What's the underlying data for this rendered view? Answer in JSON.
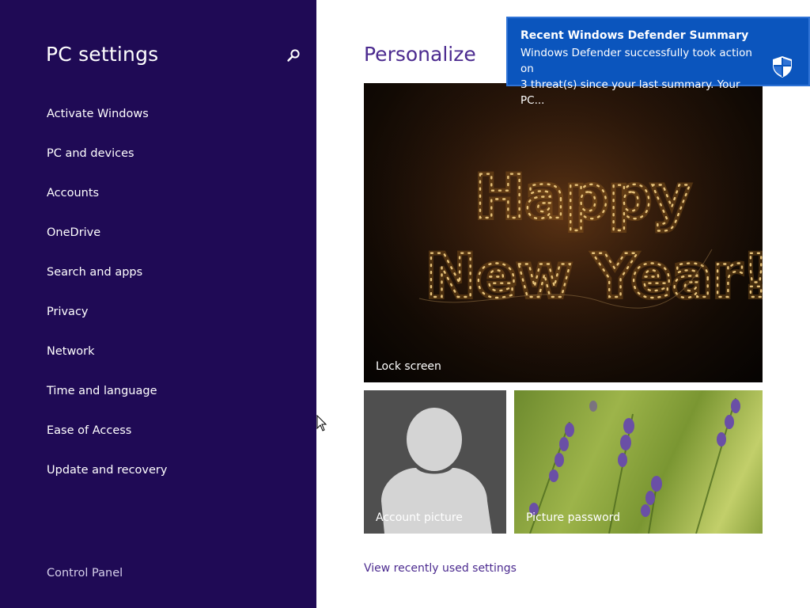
{
  "sidebar": {
    "title": "PC settings",
    "search_icon": "search-icon",
    "items": [
      {
        "label": "Activate Windows"
      },
      {
        "label": "PC and devices"
      },
      {
        "label": "Accounts"
      },
      {
        "label": "OneDrive"
      },
      {
        "label": "Search and apps"
      },
      {
        "label": "Privacy"
      },
      {
        "label": "Network"
      },
      {
        "label": "Time and language"
      },
      {
        "label": "Ease of Access"
      },
      {
        "label": "Update and recovery"
      }
    ],
    "control_panel_label": "Control Panel",
    "background_color": "#1f0a55"
  },
  "main": {
    "title": "Personalize",
    "tiles": {
      "lock_screen": {
        "label": "Lock screen",
        "image_text_line1": "Happy",
        "image_text_line2": "New Year!"
      },
      "account_picture": {
        "label": "Account picture"
      },
      "picture_password": {
        "label": "Picture password"
      }
    },
    "view_recent_label": "View recently used settings",
    "accent_color": "#4b2a8f"
  },
  "toast": {
    "title": "Recent Windows Defender Summary",
    "body": "Windows Defender successfully took action on\n3 threat(s) since your last summary. Your PC...",
    "icon": "defender-shield-icon",
    "background_color": "#0b55bd"
  }
}
